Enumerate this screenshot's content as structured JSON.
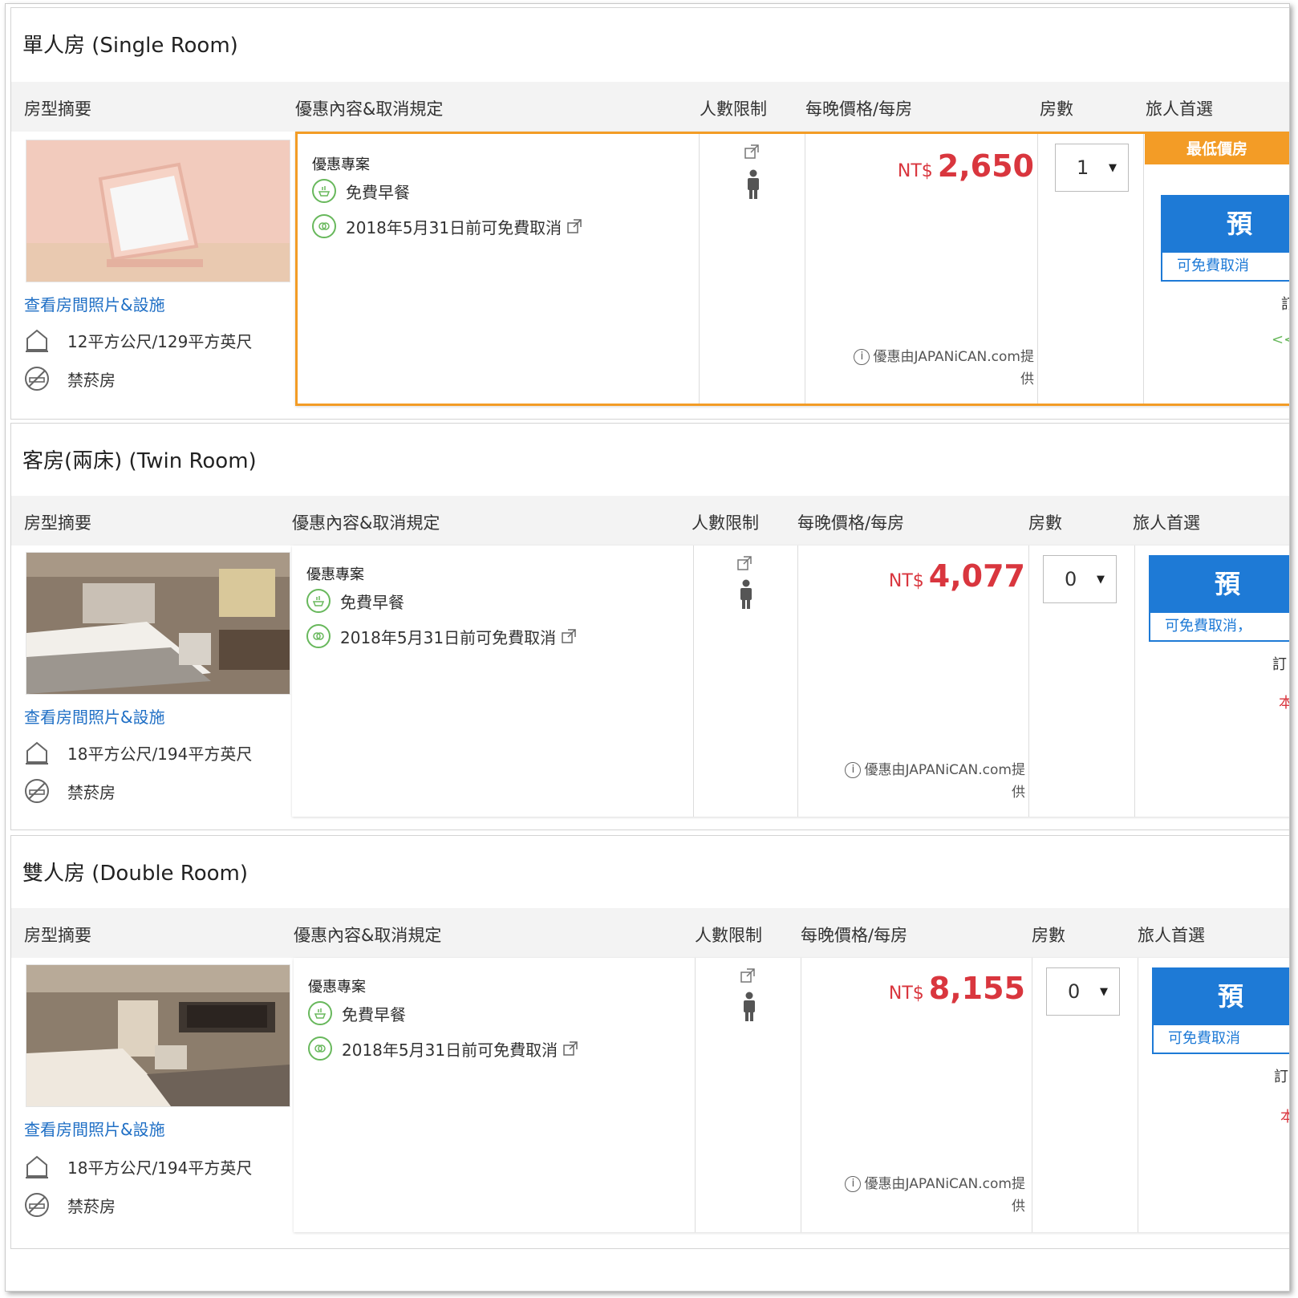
{
  "columns": {
    "summary": "房型摘要",
    "offer": "優惠內容&取消規定",
    "occupancy": "人數限制",
    "price": "每晚價格/每房",
    "rooms": "房數",
    "choice": "旅人首選"
  },
  "common": {
    "view_link": "查看房間照片&設施",
    "smoking": "禁菸房",
    "plan_label": "優惠專案",
    "breakfast": "免費早餐",
    "cancel": "2018年5月31日前可免費取消",
    "currency": "NT$",
    "provider_line1": "優惠由JAPANiCAN.com提",
    "provider_line2": "供",
    "book_label": "預",
    "cancel_short": "可免費取消"
  },
  "rooms": [
    {
      "title": "單人房 (Single Room)",
      "size": "12平方公尺/129平方英尺",
      "price": "2,650",
      "qty": "1",
      "badge": "最低價房",
      "frag_a": "訂",
      "frag_b": "<<"
    },
    {
      "title": "客房(兩床) (Twin Room)",
      "size": "18平方公尺/194平方英尺",
      "price": "4,077",
      "qty": "0",
      "book_sub": "可免費取消，",
      "frag_a": "訂",
      "frag_b": "本"
    },
    {
      "title": "雙人房 (Double Room)",
      "size": "18平方公尺/194平方英尺",
      "price": "8,155",
      "qty": "0",
      "book_sub": "可免費取消",
      "frag_a": "訂",
      "frag_b": "本"
    }
  ],
  "colors": {
    "accent": "#f39c26",
    "price": "#d9363e",
    "link": "#1f6fc5",
    "button": "#1e7ad6",
    "perk": "#68b85c"
  }
}
